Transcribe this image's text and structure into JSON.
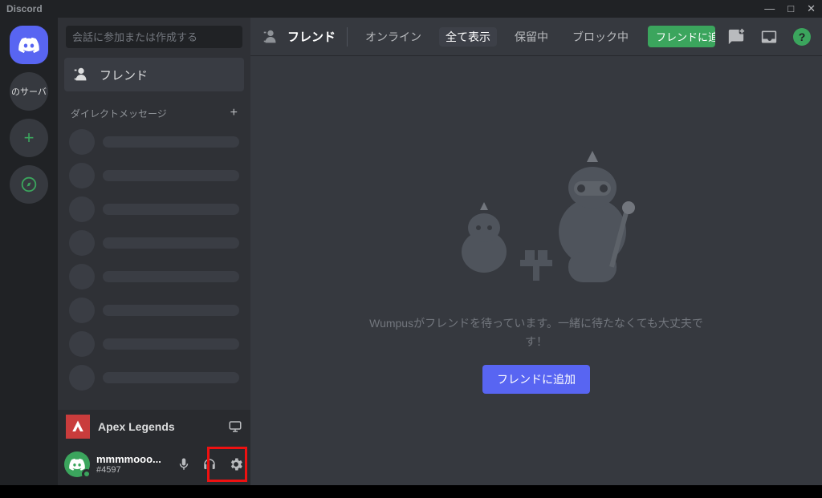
{
  "titlebar": {
    "app_name": "Discord"
  },
  "servers": {
    "partial_label": "のサーバ"
  },
  "sidebar": {
    "search_placeholder": "会話に参加または作成する",
    "friends_label": "フレンド",
    "dm_header": "ダイレクトメッセージ"
  },
  "activity": {
    "game": "Apex Legends"
  },
  "user": {
    "name": "mmmmooo...",
    "tag": "#4597"
  },
  "header": {
    "title": "フレンド",
    "tabs": {
      "online": "オンライン",
      "all": "全て表示",
      "pending": "保留中",
      "blocked": "ブロック中"
    },
    "add_friend": "フレンドに追加"
  },
  "empty": {
    "message": "Wumpusがフレンドを待っています。一緒に待たなくても大丈夫です！",
    "button": "フレンドに追加"
  }
}
